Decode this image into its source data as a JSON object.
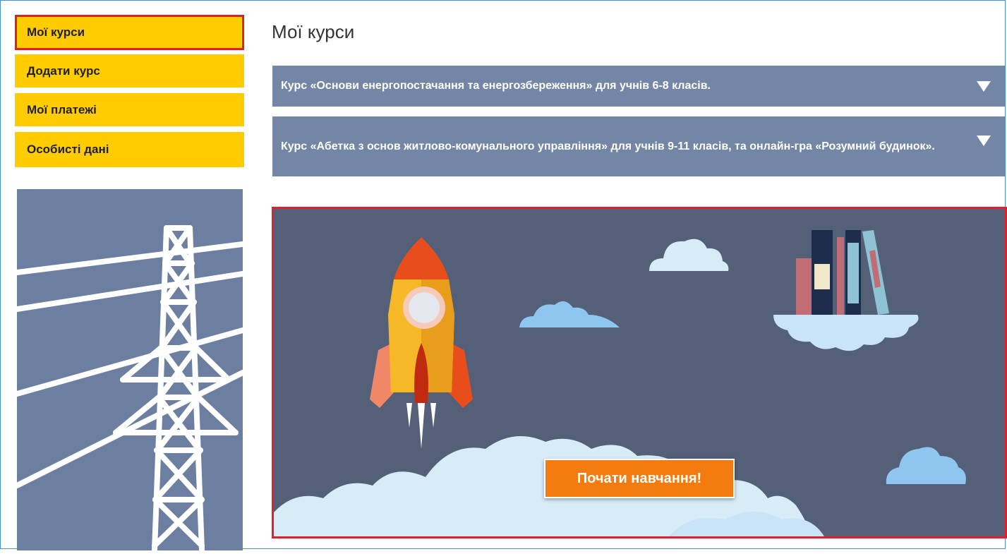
{
  "sidebar": {
    "items": [
      {
        "label": "Мої курси"
      },
      {
        "label": "Додати курс"
      },
      {
        "label": "Мої платежі"
      },
      {
        "label": "Особисті дані"
      }
    ]
  },
  "main": {
    "title": "Мої курси",
    "courses": [
      {
        "title": "Курс «Основи енергопостачання та енергозбереження» для учнів 6-8 класів."
      },
      {
        "title": "Курс «Абетка з основ житлово-комунального управління» для учнів 9-11 класів, та онлайн-гра «Розумний будинок»."
      }
    ],
    "banner": {
      "button_label": "Почати навчання!"
    }
  },
  "colors": {
    "nav_bg": "#ffcc00",
    "active_border": "#e02020",
    "accordion_bg": "#7486a6",
    "banner_bg": "#536077",
    "button_bg": "#f47b0f"
  },
  "icons": [
    "power-tower-illustration",
    "rocket-illustration",
    "books-illustration",
    "cloud-illustration",
    "triangle-down-icon"
  ]
}
